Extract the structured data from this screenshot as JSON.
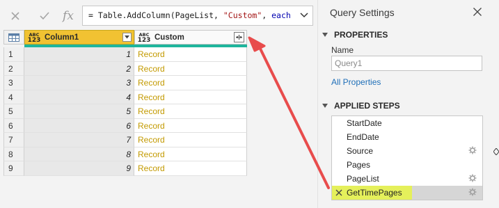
{
  "formula_bar": {
    "cancel_icon": "x-icon",
    "confirm_icon": "check-icon",
    "fx_label": "fx",
    "formula_prefix": "= Table.AddColumn(PageList, ",
    "formula_string": "\"Custom\"",
    "formula_sep": ", ",
    "formula_keyword": "each"
  },
  "table": {
    "columns": [
      {
        "type_top": "ABC",
        "type_bottom": "123",
        "name": "Column1"
      },
      {
        "type_top": "ABC",
        "type_bottom": "123",
        "name": "Custom"
      }
    ],
    "rows": [
      {
        "index": "1",
        "value": "1",
        "custom": "Record"
      },
      {
        "index": "2",
        "value": "2",
        "custom": "Record"
      },
      {
        "index": "3",
        "value": "3",
        "custom": "Record"
      },
      {
        "index": "4",
        "value": "4",
        "custom": "Record"
      },
      {
        "index": "5",
        "value": "5",
        "custom": "Record"
      },
      {
        "index": "6",
        "value": "6",
        "custom": "Record"
      },
      {
        "index": "7",
        "value": "7",
        "custom": "Record"
      },
      {
        "index": "8",
        "value": "8",
        "custom": "Record"
      },
      {
        "index": "9",
        "value": "9",
        "custom": "Record"
      }
    ]
  },
  "query_settings": {
    "title": "Query Settings",
    "properties_header": "PROPERTIES",
    "name_label": "Name",
    "name_value": "Query1",
    "all_properties": "All Properties",
    "applied_steps_header": "APPLIED STEPS",
    "steps": [
      {
        "label": "StartDate",
        "gear": false
      },
      {
        "label": "EndDate",
        "gear": false
      },
      {
        "label": "Source",
        "gear": true
      },
      {
        "label": "Pages",
        "gear": false
      },
      {
        "label": "PageList",
        "gear": true
      },
      {
        "label": "GetTimePages",
        "gear": true,
        "selected": true
      }
    ]
  },
  "colors": {
    "column1_header": "#f1c232",
    "record_text": "#c39a00",
    "quality_bar": "#1fb59c",
    "arrow": "#e84c4c",
    "link": "#1f6fb8",
    "step_highlight": "#e9f63c"
  }
}
